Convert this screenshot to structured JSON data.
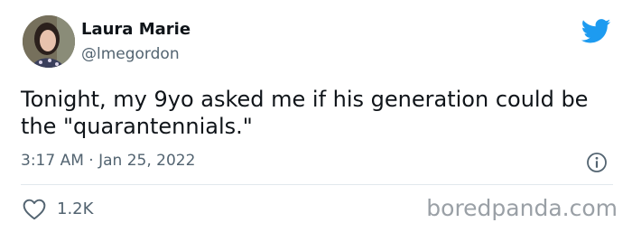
{
  "tweet": {
    "author": {
      "display_name": "Laura Marie",
      "handle": "@lmegordon",
      "avatar_icon": "profile-photo"
    },
    "text": "Tonight, my 9yo asked me if his generation could be the \"quarantennials.\"",
    "timestamp": "3:17 AM · Jan 25, 2022",
    "likes": "1.2K",
    "brand_icon": "twitter-bird-icon",
    "brand_color": "#1d9bf0"
  },
  "watermark": {
    "text": "boredpanda.com"
  }
}
